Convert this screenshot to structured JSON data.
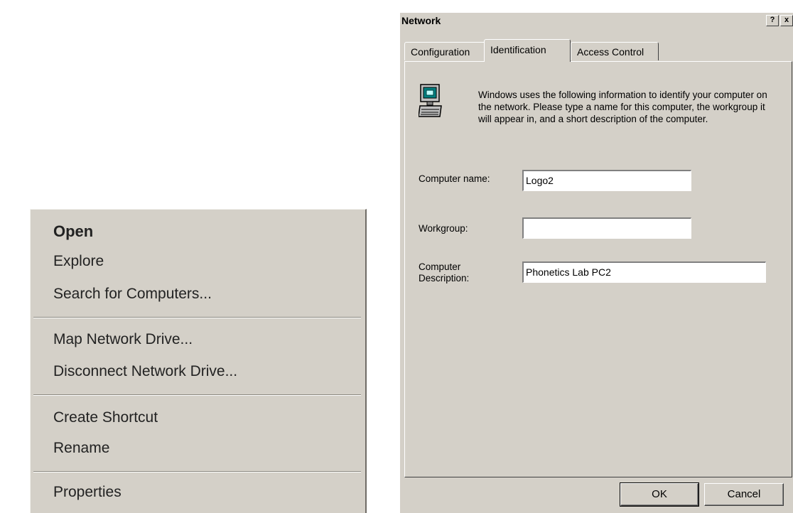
{
  "context_menu": {
    "items": [
      {
        "label": "Open",
        "bold": true
      },
      {
        "label": "Explore"
      },
      {
        "label": "Search for Computers..."
      },
      {
        "label": "Map Network Drive..."
      },
      {
        "label": "Disconnect Network Drive..."
      },
      {
        "label": "Create Shortcut"
      },
      {
        "label": "Rename"
      },
      {
        "label": "Properties"
      }
    ]
  },
  "dialog": {
    "title": "Network",
    "help_button": "?",
    "close_button": "x",
    "tabs": [
      {
        "label": "Configuration",
        "active": false
      },
      {
        "label": "Identification",
        "active": true
      },
      {
        "label": "Access Control",
        "active": false
      }
    ],
    "description": "Windows uses the following information to identify your computer on the network.  Please type a name for this computer, the workgroup it will appear in, and a short description of the computer.",
    "fields": {
      "computer_name": {
        "label": "Computer name:",
        "value": "Logo2"
      },
      "workgroup": {
        "label": "Workgroup:",
        "value": ""
      },
      "computer_description": {
        "label_line1": "Computer",
        "label_line2": "Description:",
        "value": "Phonetics Lab PC2"
      }
    },
    "buttons": {
      "ok": "OK",
      "cancel": "Cancel"
    }
  },
  "colors": {
    "face": "#d4d0c8",
    "shadow": "#808080",
    "highlight": "#ffffff"
  }
}
